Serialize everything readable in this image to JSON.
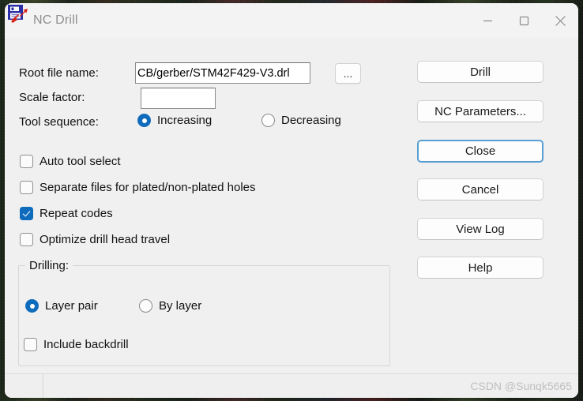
{
  "window": {
    "title": "NC Drill",
    "icon": "nc-drill-app-icon",
    "controls": {
      "minimize": "minimize-icon",
      "maximize": "maximize-icon",
      "close": "close-icon"
    }
  },
  "form": {
    "root_file": {
      "label": "Root file name:",
      "value": "CB/gerber/STM42F429-V3.drl",
      "placeholder": "",
      "browse_label": "..."
    },
    "scale_factor": {
      "label": "Scale factor:",
      "value": "",
      "placeholder": ""
    },
    "tool_sequence": {
      "label": "Tool sequence:",
      "options": [
        {
          "label": "Increasing",
          "checked": true
        },
        {
          "label": "Decreasing",
          "checked": false
        }
      ]
    }
  },
  "options": [
    {
      "label": "Auto tool select",
      "checked": false
    },
    {
      "label": "Separate files for plated/non-plated holes",
      "checked": false
    },
    {
      "label": "Repeat codes",
      "checked": true
    },
    {
      "label": "Optimize drill head travel",
      "checked": false
    }
  ],
  "drilling_group": {
    "legend": "Drilling:",
    "mode_options": [
      {
        "label": "Layer pair",
        "checked": true
      },
      {
        "label": "By layer",
        "checked": false
      }
    ],
    "include_backdrill": {
      "label": "Include backdrill",
      "checked": false
    }
  },
  "buttons": [
    {
      "label": "Drill",
      "focused": false
    },
    {
      "label": "NC Parameters...",
      "focused": false
    },
    {
      "label": "Close",
      "focused": true
    },
    {
      "label": "Cancel",
      "focused": false
    },
    {
      "label": "View Log",
      "focused": false
    },
    {
      "label": "Help",
      "focused": false
    }
  ],
  "statusbar": {
    "message": "",
    "watermark": "CSDN @Sunqk5665"
  },
  "colors": {
    "accent": "#0f6cbd",
    "focus_border": "#5a9fd4",
    "window_bg": "#f0f0f0",
    "title_text": "#8e8e8e",
    "watermark": "#bfbfbf"
  }
}
